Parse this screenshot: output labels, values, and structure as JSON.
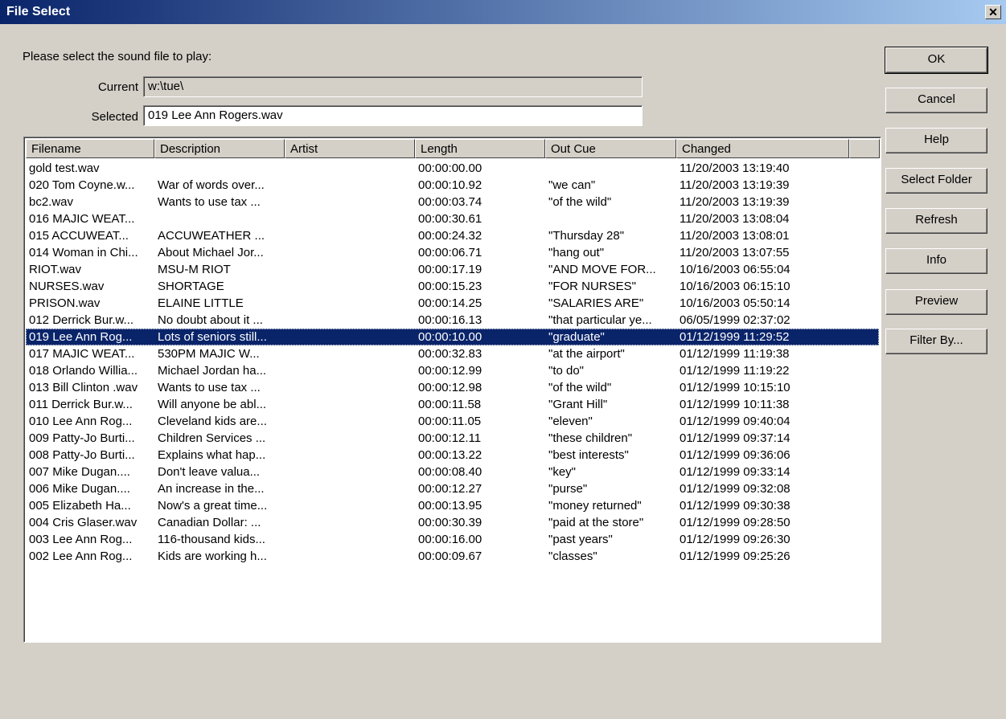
{
  "window": {
    "title": "File Select",
    "close_glyph": "✕"
  },
  "prompt": "Please select the sound file to play:",
  "current": {
    "label": "Current",
    "value": "w:\\tue\\"
  },
  "selected": {
    "label": "Selected",
    "value": "019 Lee Ann Rogers.wav"
  },
  "columns": [
    "Filename",
    "Description",
    "Artist",
    "Length",
    "Out Cue",
    "Changed"
  ],
  "rows": [
    [
      "gold test.wav",
      "",
      "",
      "00:00:00.00",
      "",
      "11/20/2003 13:19:40"
    ],
    [
      "020 Tom Coyne.w...",
      "War of words over...",
      "",
      "00:00:10.92",
      "\"we can\"",
      "11/20/2003 13:19:39"
    ],
    [
      "bc2.wav",
      "Wants to use tax ...",
      "",
      "00:00:03.74",
      "\"of the wild\"",
      "11/20/2003 13:19:39"
    ],
    [
      "016 MAJIC WEAT...",
      "",
      "",
      "00:00:30.61",
      "",
      "11/20/2003 13:08:04"
    ],
    [
      "015 ACCUWEAT...",
      "ACCUWEATHER ...",
      "",
      "00:00:24.32",
      "\"Thursday 28\"",
      "11/20/2003 13:08:01"
    ],
    [
      "014 Woman in Chi...",
      "About Michael Jor...",
      "",
      "00:00:06.71",
      "\"hang out\"",
      "11/20/2003 13:07:55"
    ],
    [
      "RIOT.wav",
      "MSU-M RIOT",
      "",
      "00:00:17.19",
      "\"AND MOVE FOR...",
      "10/16/2003 06:55:04"
    ],
    [
      "NURSES.wav",
      "SHORTAGE",
      "",
      "00:00:15.23",
      "\"FOR NURSES\"",
      "10/16/2003 06:15:10"
    ],
    [
      "PRISON.wav",
      "ELAINE LITTLE",
      "",
      "00:00:14.25",
      "\"SALARIES ARE\"",
      "10/16/2003 05:50:14"
    ],
    [
      "012 Derrick Bur.w...",
      "No doubt about it ...",
      "",
      "00:00:16.13",
      "\"that particular ye...",
      "06/05/1999 02:37:02"
    ],
    [
      "019 Lee Ann Rog...",
      "Lots of seniors still...",
      "",
      "00:00:10.00",
      "\"graduate\"",
      "01/12/1999 11:29:52"
    ],
    [
      "017 MAJIC WEAT...",
      "530PM MAJIC W...",
      "",
      "00:00:32.83",
      "\"at the airport\"",
      "01/12/1999 11:19:38"
    ],
    [
      "018 Orlando Willia...",
      "Michael Jordan ha...",
      "",
      "00:00:12.99",
      "\"to do\"",
      "01/12/1999 11:19:22"
    ],
    [
      "013 Bill Clinton .wav",
      "Wants to use tax ...",
      "",
      "00:00:12.98",
      "\"of the wild\"",
      "01/12/1999 10:15:10"
    ],
    [
      "011 Derrick Bur.w...",
      "Will anyone be abl...",
      "",
      "00:00:11.58",
      "\"Grant Hill\"",
      "01/12/1999 10:11:38"
    ],
    [
      "010 Lee Ann Rog...",
      "Cleveland kids are...",
      "",
      "00:00:11.05",
      "\"eleven\"",
      "01/12/1999 09:40:04"
    ],
    [
      "009 Patty-Jo Burti...",
      "Children Services ...",
      "",
      "00:00:12.11",
      "\"these children\"",
      "01/12/1999 09:37:14"
    ],
    [
      "008 Patty-Jo Burti...",
      "Explains what hap...",
      "",
      "00:00:13.22",
      "\"best interests\"",
      "01/12/1999 09:36:06"
    ],
    [
      "007 Mike Dugan....",
      "Don't leave valua...",
      "",
      "00:00:08.40",
      "\"key\"",
      "01/12/1999 09:33:14"
    ],
    [
      "006 Mike Dugan....",
      "An increase in the...",
      "",
      "00:00:12.27",
      "\"purse\"",
      "01/12/1999 09:32:08"
    ],
    [
      "005 Elizabeth Ha...",
      "Now's a great time...",
      "",
      "00:00:13.95",
      "\"money returned\"",
      "01/12/1999 09:30:38"
    ],
    [
      "004 Cris Glaser.wav",
      "Canadian Dollar: ...",
      "",
      "00:00:30.39",
      "\"paid at the store\"",
      "01/12/1999 09:28:50"
    ],
    [
      "003 Lee Ann Rog...",
      "116-thousand kids...",
      "",
      "00:00:16.00",
      "\"past years\"",
      "01/12/1999 09:26:30"
    ],
    [
      "002 Lee Ann Rog...",
      "Kids are working h...",
      "",
      "00:00:09.67",
      "\"classes\"",
      "01/12/1999 09:25:26"
    ]
  ],
  "selected_row_index": 10,
  "buttons": [
    "OK",
    "Cancel",
    "Help",
    "Select Folder",
    "Refresh",
    "Info",
    "Preview",
    "Filter By..."
  ],
  "colors": {
    "titlebar_start": "#0a246a",
    "titlebar_end": "#a6caf0",
    "selection": "#0a246a",
    "face": "#d4d0c8"
  }
}
